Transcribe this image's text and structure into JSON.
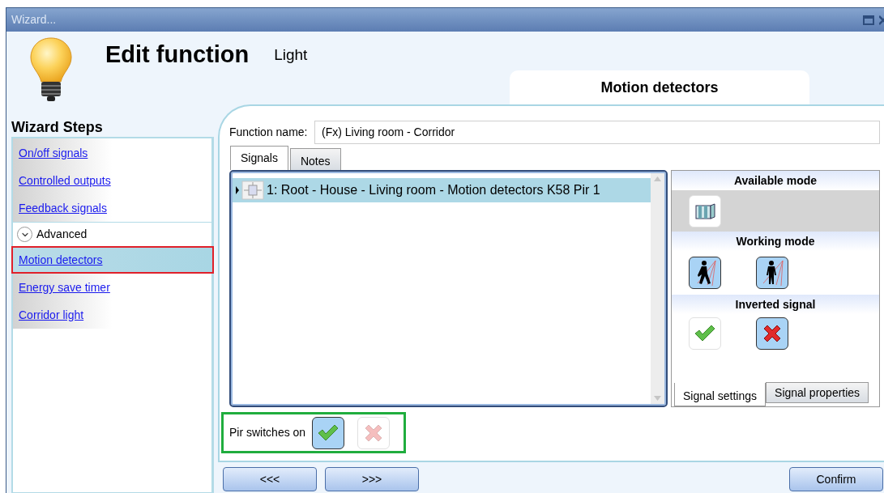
{
  "window": {
    "title": "Wizard..."
  },
  "header": {
    "title": "Edit function",
    "subtitle": "Light",
    "step_tab": "Motion detectors"
  },
  "wizard_steps": {
    "title": "Wizard Steps",
    "items": [
      {
        "label": "On/off signals",
        "selected": false
      },
      {
        "label": "Controlled outputs",
        "selected": false
      },
      {
        "label": "Feedback signals",
        "selected": false
      }
    ],
    "advanced": {
      "label": "Advanced",
      "expanded": true,
      "items": [
        {
          "label": "Motion detectors",
          "selected": true
        },
        {
          "label": "Energy save timer",
          "selected": false
        },
        {
          "label": "Corridor light",
          "selected": false
        }
      ]
    }
  },
  "function_name": {
    "label": "Function name:",
    "value": "(Fx) Living room - Corridor"
  },
  "tabs": [
    {
      "label": "Signals",
      "selected": true
    },
    {
      "label": "Notes",
      "selected": false
    }
  ],
  "signals": [
    {
      "label": "1: Root - House - Living room - Motion detectors K58 Pir 1",
      "selected": true
    }
  ],
  "settings": {
    "sections": [
      {
        "title": "Available mode",
        "options": [
          {
            "kind": "detector",
            "selected": false
          }
        ]
      },
      {
        "title": "Working mode",
        "options": [
          {
            "kind": "walking",
            "selected": true
          },
          {
            "kind": "standing",
            "selected": true
          }
        ]
      },
      {
        "title": "Inverted signal",
        "options": [
          {
            "kind": "check",
            "selected": false
          },
          {
            "kind": "cross",
            "selected": true
          }
        ]
      }
    ],
    "tabs": [
      {
        "label": "Signal settings",
        "selected": true
      },
      {
        "label": "Signal properties",
        "selected": false
      }
    ]
  },
  "pir_switches": {
    "label": "Pir switches on",
    "options": [
      {
        "kind": "check",
        "selected": true
      },
      {
        "kind": "cross",
        "selected": false
      }
    ]
  },
  "buttons": [
    {
      "label": "<<<",
      "kind": "back"
    },
    {
      "label": ">>>",
      "kind": "next"
    },
    {
      "label": "Confirm",
      "kind": "confirm"
    }
  ]
}
